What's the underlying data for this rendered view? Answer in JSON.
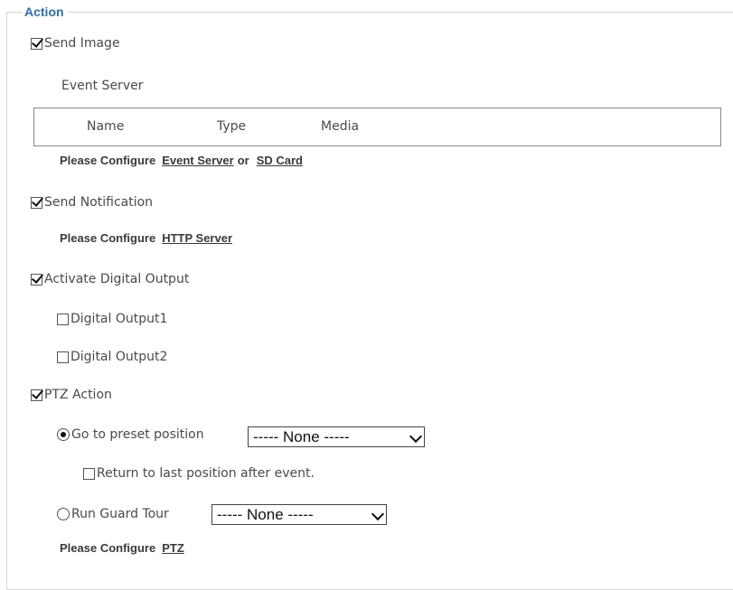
{
  "fieldset": {
    "legend": "Action"
  },
  "send_image": {
    "checked": true,
    "label": "Send Image",
    "event_server_label": "Event Server",
    "columns": [
      "Name",
      "Type",
      "Media"
    ],
    "configure_prefix": "Please Configure",
    "link_event_server": "Event Server",
    "or_text": "or",
    "link_sd_card": "SD Card"
  },
  "send_notification": {
    "checked": true,
    "label": "Send Notification",
    "configure_prefix": "Please Configure",
    "link_http_server": "HTTP Server"
  },
  "digital_output": {
    "checked": true,
    "label": "Activate Digital Output",
    "outputs": [
      {
        "label": "Digital Output1",
        "checked": false
      },
      {
        "label": "Digital Output2",
        "checked": false
      }
    ]
  },
  "ptz": {
    "checked": true,
    "label": "PTZ Action",
    "preset": {
      "selected": true,
      "label": "Go to preset position",
      "select_value": "----- None -----"
    },
    "return_last": {
      "checked": false,
      "label": "Return to last position after event."
    },
    "guard_tour": {
      "selected": false,
      "label": "Run Guard Tour",
      "select_value": "----- None -----"
    },
    "configure_prefix": "Please Configure",
    "link_ptz": "PTZ"
  }
}
